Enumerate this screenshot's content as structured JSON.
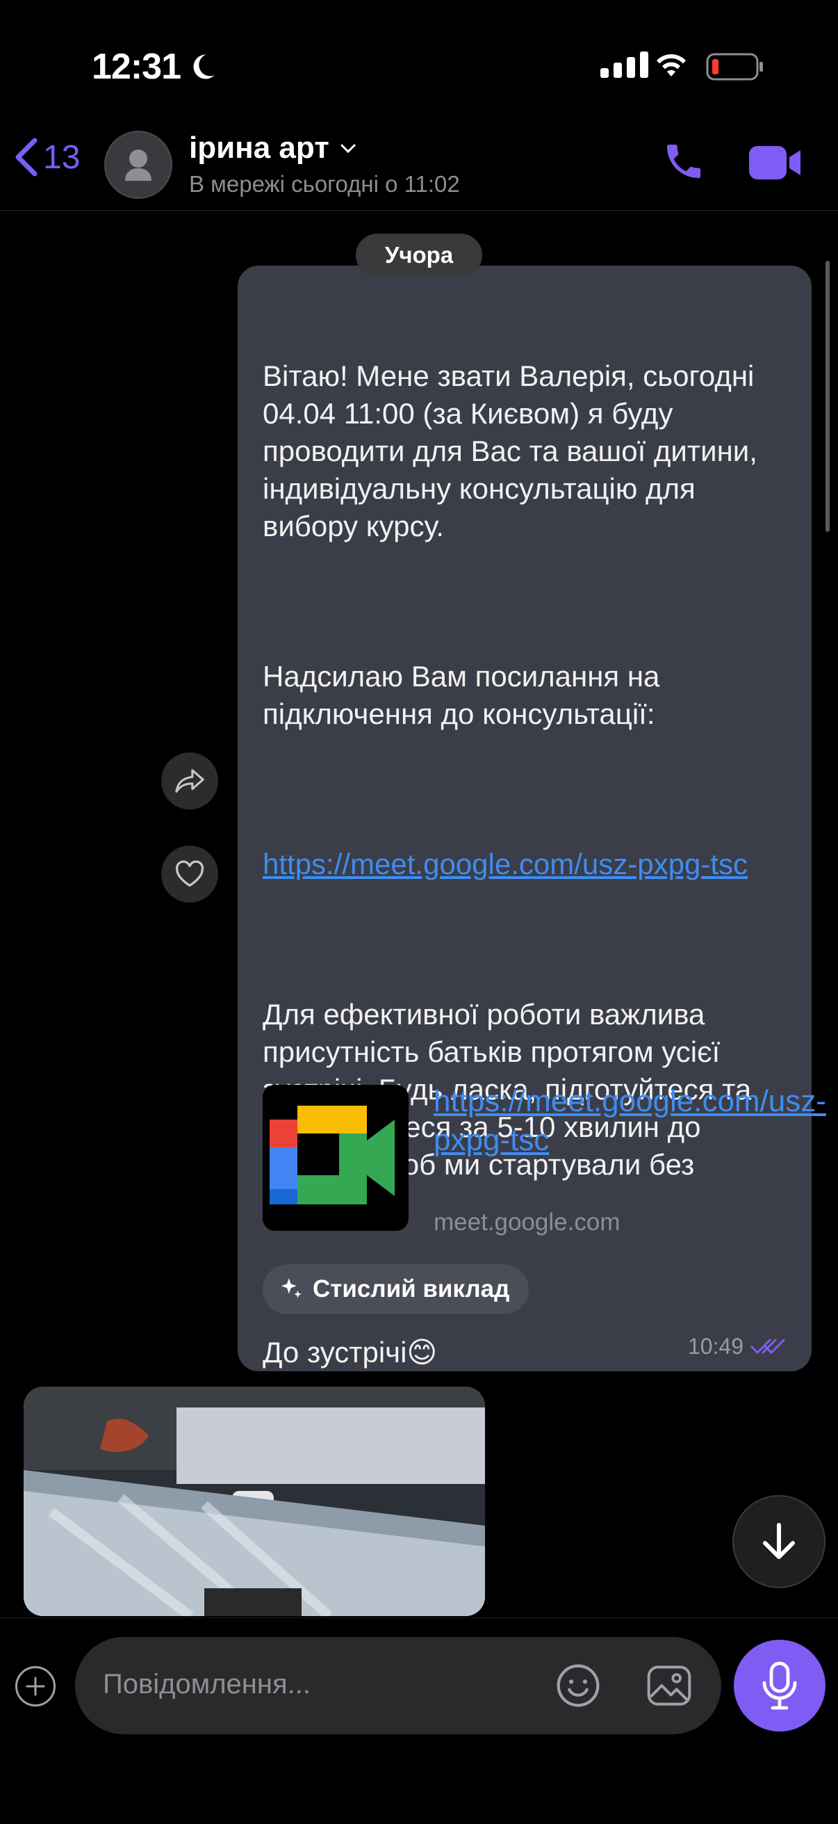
{
  "status_bar": {
    "time": "12:31"
  },
  "header": {
    "back_count": "13",
    "contact_name": "ірина арт",
    "presence": "В мережі сьогодні о 11:02"
  },
  "chat": {
    "date_label": "Учора",
    "message": {
      "para1": "Вітаю! Мене звати Валерія, сьогодні 04.04 11:00 (за Києвом) я буду проводити для Вас та вашої дитини, індивідуальну консультацію для вибору курсу.",
      "para2": "Надсилаю Вам посилання на підключення до консультації:",
      "link": "https://meet.google.com/usz-pxpg-tsc",
      "para3": "Для ефективної роботи важлива присутність батьків протягом усієї зустрічі. Будь ласка, підготуйтеся та приєднайтеся за 5-10 хвилин до початку, щоб ми стартували без затримок.",
      "para4": "До зустрічі",
      "para4_emoji": "😊",
      "preview_link": "https://meet.google.com/usz-pxpg-tsc",
      "preview_domain": "meet.google.com",
      "summary_label": "Стислий виклад",
      "time": "10:49"
    }
  },
  "composer": {
    "placeholder": "Повідомлення..."
  },
  "colors": {
    "accent": "#7f5cf4",
    "bubble": "#3b3e48",
    "link": "#3f8cf2"
  }
}
